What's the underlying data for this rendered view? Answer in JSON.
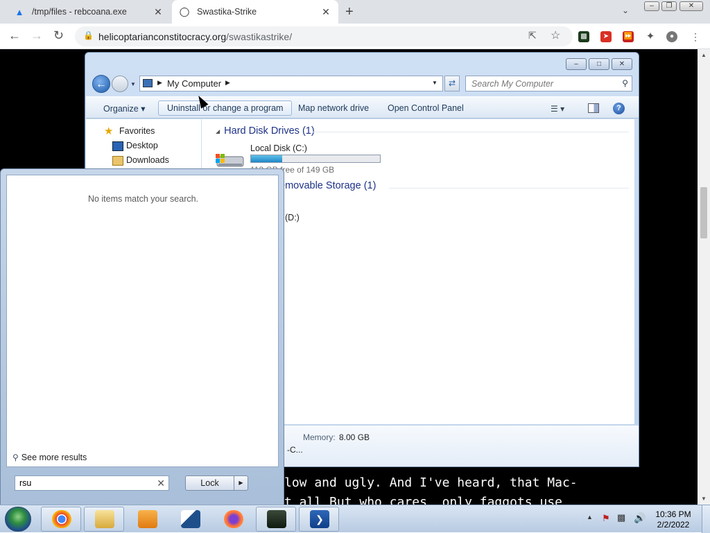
{
  "browser": {
    "tabs": [
      {
        "title": "/tmp/files - rebcoana.exe",
        "favicon": "drive-icon",
        "active": false
      },
      {
        "title": "Swastika-Strike",
        "favicon": "site-logo-icon",
        "active": true
      }
    ],
    "url_domain": "helicoptarianconstitocracy.org",
    "url_path": "/swastikastrike/",
    "accent": "#1a73e8"
  },
  "page": {
    "lines": [
      "low and ugly. And I've heard, that Mac-",
      "t all But who cares  only faggots use"
    ]
  },
  "explorer": {
    "breadcrumb": "My Computer",
    "search_placeholder": "Search My Computer",
    "commands": [
      "Organize",
      "Uninstall or change a program",
      "Map network drive",
      "Open Control Panel"
    ],
    "nav": [
      {
        "label": "Favorites",
        "icon": "star-icon"
      },
      {
        "label": "Desktop",
        "icon": "desktop-icon"
      },
      {
        "label": "Downloads",
        "icon": "downloads-folder-icon"
      }
    ],
    "groups": [
      {
        "title": "Hard Disk Drives (1)"
      },
      {
        "title": "emovable Storage (1)"
      }
    ],
    "disk": {
      "name": "Local Disk (C:)",
      "free_text": "113 GB free of 149 GB",
      "used_fraction": 0.24
    },
    "dvd": {
      "name": "(D:)"
    },
    "details": {
      "memory_label": "Memory:",
      "memory_value": "8.00 GB",
      "cpu_text": "-C..."
    }
  },
  "startmenu": {
    "no_items": "No items match your search.",
    "see_more": "See more results",
    "search_value": "rsu",
    "lock_label": "Lock"
  },
  "taskbar": {
    "time": "10:36 PM",
    "date": "2/2/2022",
    "apps": [
      "chrome-icon",
      "file-explorer-icon",
      "media-player-icon",
      "kdenlive-icon",
      "firefox-icon",
      "terminal-icon",
      "powershell-icon"
    ]
  }
}
